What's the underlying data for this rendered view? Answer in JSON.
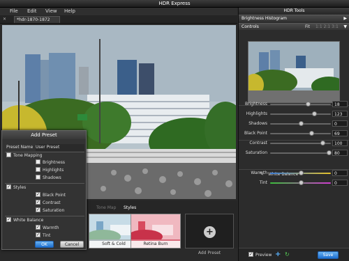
{
  "window": {
    "title": "HDR Express"
  },
  "menu": {
    "file": "File",
    "edit": "Edit",
    "view": "View",
    "help": "Help"
  },
  "document": {
    "tab": "*hdr-1870-1872"
  },
  "bottom": {
    "tone_map_tab": "Tone Map",
    "styles_tab": "Styles",
    "presets": [
      {
        "label": "Soft & Cold"
      },
      {
        "label": "Retina Burn"
      }
    ],
    "add_preset_label": "Add Preset"
  },
  "dialog": {
    "title": "Add Preset",
    "name_label": "Preset Name",
    "name_value": "User Preset",
    "tone_mapping": "Tone Mapping",
    "brightness": "Brightness",
    "highlights": "Highlights",
    "shadows": "Shadows",
    "styles": "Styles",
    "black_point": "Black Point",
    "contrast": "Contrast",
    "saturation": "Saturation",
    "white_balance": "White Balance",
    "warmth": "Warmth",
    "tint": "Tint",
    "ok": "OK",
    "cancel": "Cancel"
  },
  "panel": {
    "title": "HDR Tools",
    "histogram_header": "Brightness Histogram",
    "controls_header": "Controls",
    "fit": "Fit",
    "zoom_options": "1:1   2:1   3:1",
    "sliders": [
      {
        "label": "Brightness",
        "value": "18",
        "level": 0.62
      },
      {
        "label": "Highlights",
        "value": "123",
        "level": 0.72
      },
      {
        "label": "Shadows",
        "value": "0",
        "level": 0.5
      },
      {
        "label": "Black Point",
        "value": "69",
        "level": 0.68
      },
      {
        "label": "Contrast",
        "value": "100",
        "level": 0.86
      },
      {
        "label": "Saturation",
        "value": "80",
        "level": 0.96
      },
      {
        "label": "Warmth",
        "value": "0",
        "level": 0.5
      },
      {
        "label": "Tint",
        "value": "0",
        "level": 0.5
      }
    ],
    "white_balance": "White Balance",
    "preview": "Preview",
    "save": "Save"
  }
}
